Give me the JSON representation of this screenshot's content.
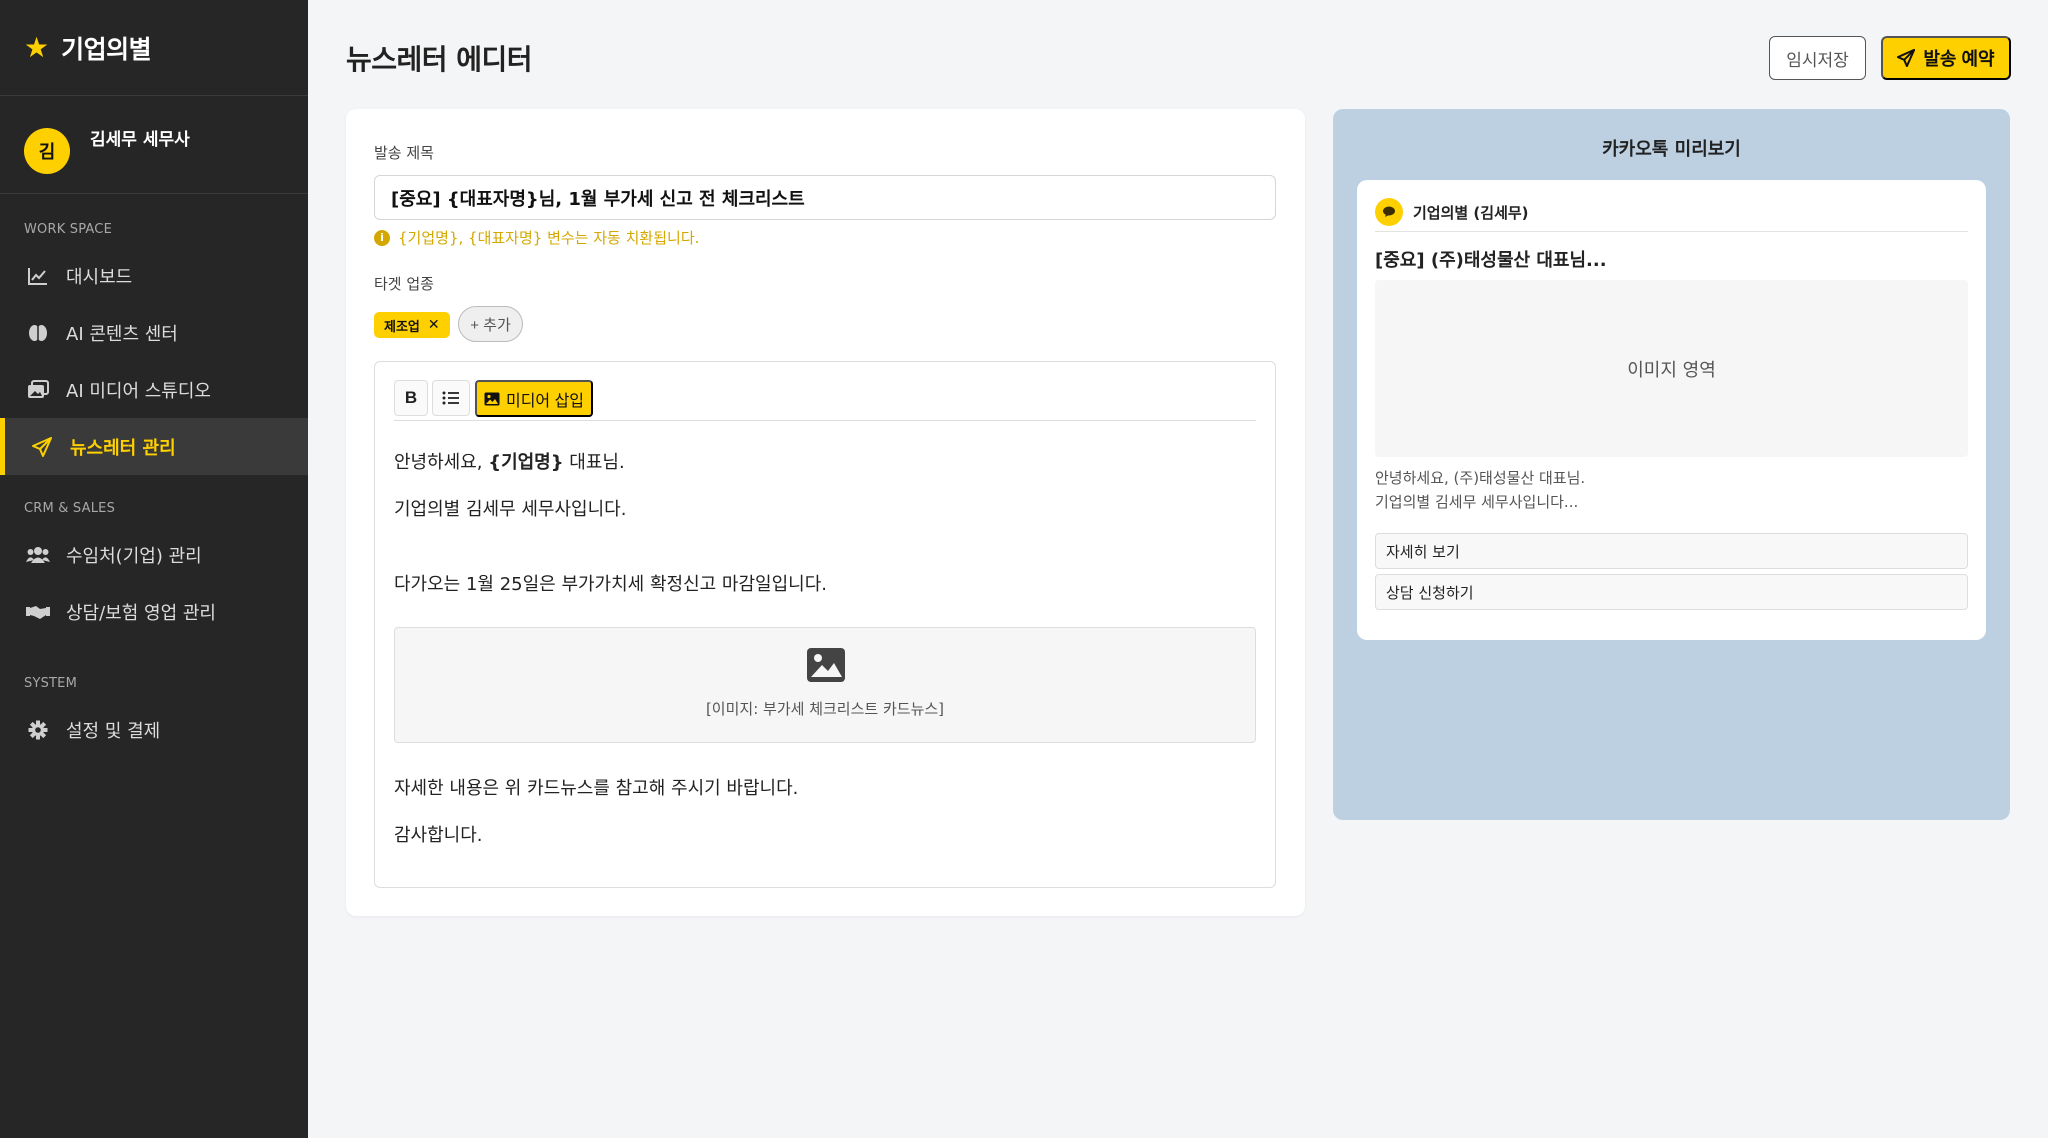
{
  "sidebar": {
    "brand": "기업의별",
    "profile": {
      "avatar": "김",
      "name": "김세무 세무사"
    },
    "sections": {
      "workspace": "WORK SPACE",
      "crm": "CRM & SALES",
      "system": "SYSTEM"
    },
    "items": [
      {
        "label": "대시보드",
        "icon": "chart-line-icon"
      },
      {
        "label": "AI 콘텐츠 센터",
        "icon": "brain-icon"
      },
      {
        "label": "AI 미디어 스튜디오",
        "icon": "images-icon"
      },
      {
        "label": "뉴스레터 관리",
        "icon": "paper-plane-icon",
        "active": true
      },
      {
        "label": "수임처(기업) 관리",
        "icon": "users-icon"
      },
      {
        "label": "상담/보험 영업 관리",
        "icon": "handshake-icon"
      },
      {
        "label": "설정 및 결제",
        "icon": "gear-icon"
      }
    ]
  },
  "header": {
    "title": "뉴스레터 에디터",
    "draft_label": "임시저장",
    "send_label": "발송 예약"
  },
  "editor": {
    "subject_label": "발송 제목",
    "subject_value": "[중요] {대표자명}님, 1월 부가세 신고 전 체크리스트",
    "hint": "{기업명}, {대표자명} 변수는 자동 치환됩니다.",
    "target_label": "타겟 업종",
    "tags": [
      "제조업"
    ],
    "add_tag_label": "+ 추가",
    "toolbar": {
      "bold": "B",
      "media_label": "미디어 삽입"
    },
    "body": {
      "greeting_prefix": "안녕하세요, ",
      "greeting_var": "{기업명}",
      "greeting_suffix": " 대표님.",
      "line2": "기업의별 김세무 세무사입니다.",
      "line3": "다가오는 1월 25일은 부가가치세 확정신고 마감일입니다.",
      "image_caption": "[이미지: 부가세 체크리스트 카드뉴스]",
      "line4": "자세한 내용은 위 카드뉴스를 참고해 주시기 바랍니다.",
      "line5": "감사합니다."
    }
  },
  "preview": {
    "title": "카카오톡 미리보기",
    "sender": "기업의별 (김세무)",
    "message_title": "[중요] (주)태성물산 대표님...",
    "image_area": "이미지 영역",
    "text_line1": "안녕하세요, (주)태성물산 대표님.",
    "text_line2": "기업의별 김세무 세무사입니다...",
    "buttons": [
      "자세히 보기",
      "상담 신청하기"
    ]
  },
  "colors": {
    "accent": "#ffd000",
    "sidebar_bg": "#262626",
    "preview_bg": "#bcd0e2"
  }
}
